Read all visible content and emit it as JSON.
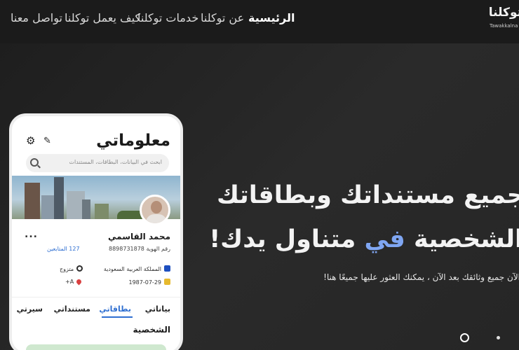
{
  "nav": {
    "brand_ar": "توكلنا",
    "brand_en": "Tawakkalna",
    "links": [
      {
        "label": "الرئيسية",
        "active": true
      },
      {
        "label": "عن توكلنا",
        "active": false
      },
      {
        "label": "خدمات توكلنا",
        "active": false
      },
      {
        "label": "كيف يعمل توكلنا",
        "active": false
      },
      {
        "label": "تواصل معنا",
        "active": false
      }
    ]
  },
  "hero": {
    "line1": "جميع مستنداتك وبطاقاتك",
    "line2_start": "الشخصية ",
    "line2_accent": "في",
    "line2_end": " متناول يدك!",
    "subtitle": "الآن جميع وثائقك بعد الآن ، يمكنك العثور عليها جميعًا هنا!"
  },
  "phone": {
    "title": "معلوماتي",
    "search_placeholder": "ابحث في البيانات، البطاقات، المستندات",
    "name": "محمد القاسمي",
    "id_label": "رقم الهوية 8898731878",
    "followers": "127 المتابعين",
    "country": "المملكة العربية السعودية",
    "marital": "متزوج",
    "dob": "1987-07-29",
    "blood": "A+",
    "more": "...",
    "tabs": [
      "بياناتي",
      "بطاقاتي",
      "مستنداتي",
      "سيرتي"
    ],
    "section_title": "الشخصية"
  },
  "colors": {
    "accent": "#7fa6f2",
    "tab_active": "#2f6fd1"
  }
}
